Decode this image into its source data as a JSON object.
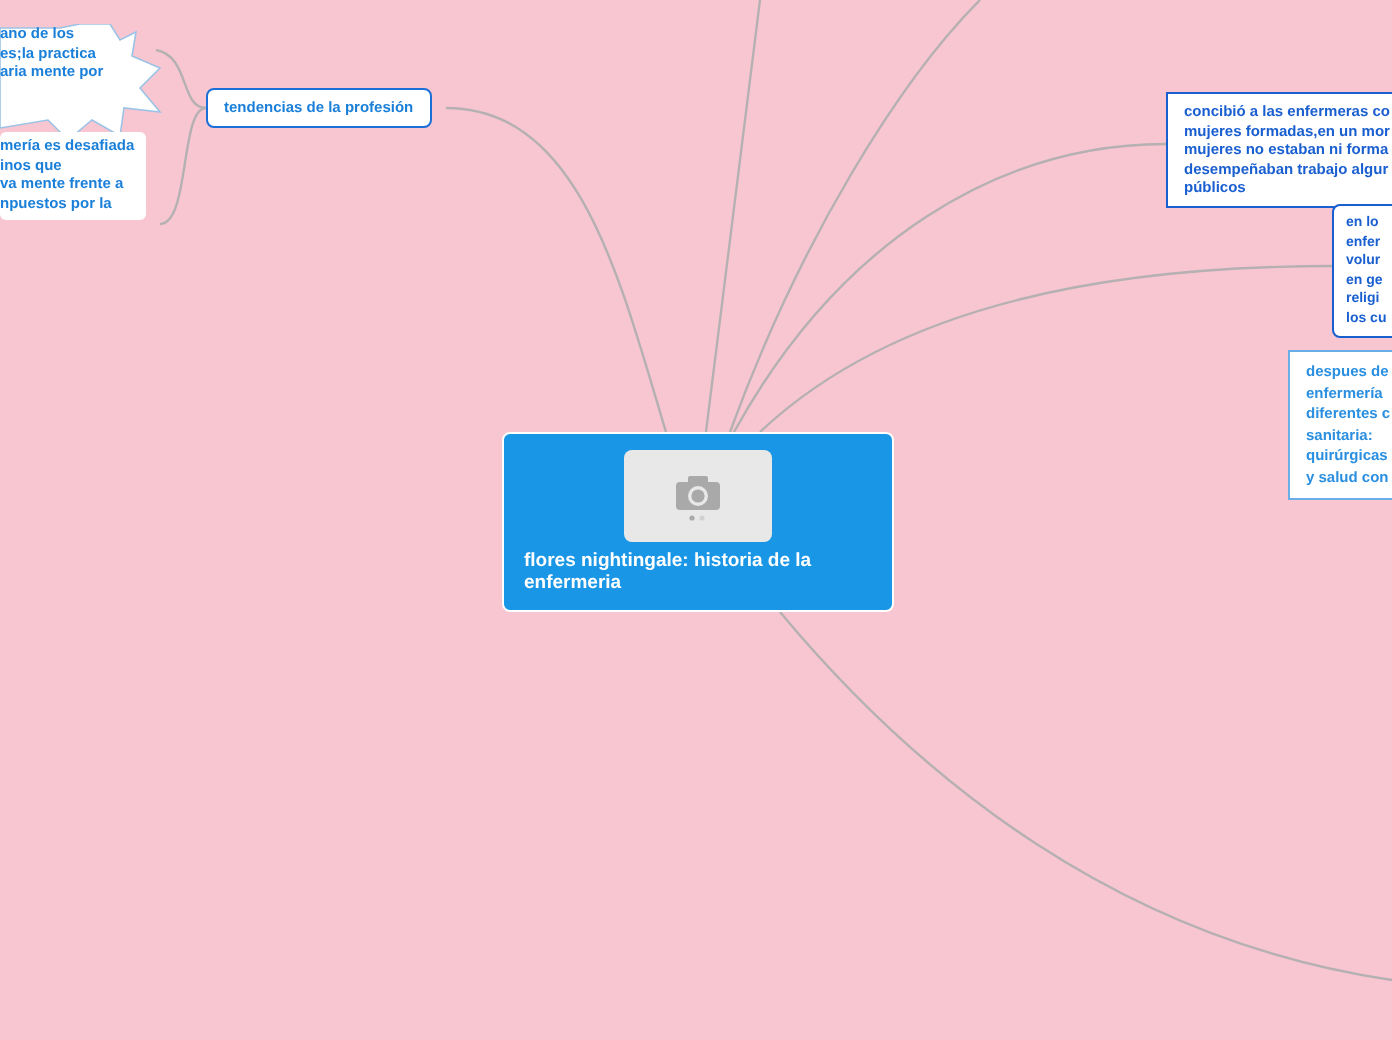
{
  "central": {
    "title": "flores nightingale: historia de la enfermeria"
  },
  "nodes": [
    {
      "kind": "topic",
      "text": "tendencias de la profesión"
    },
    {
      "kind": "starburst",
      "text": "ano de los\nes;la practica\naria mente por"
    },
    {
      "kind": "note",
      "text": "mería es desafiada\ninos que\nva mente frente a\nnpuestos por la"
    },
    {
      "kind": "box",
      "text": "concibió a las enfermeras co\nmujeres formadas,en un mor\nmujeres no estaban ni forma\ndesempeñaban trabajo algur\npúblicos"
    },
    {
      "kind": "rounded",
      "text": "en lo\nenfer\nvolur\nen ge\nreligi\nlos cu"
    },
    {
      "kind": "light",
      "text": "despues de\nenfermería\ndiferentes c\nsanitaria:\nquirúrgicas\ny salud con"
    }
  ]
}
